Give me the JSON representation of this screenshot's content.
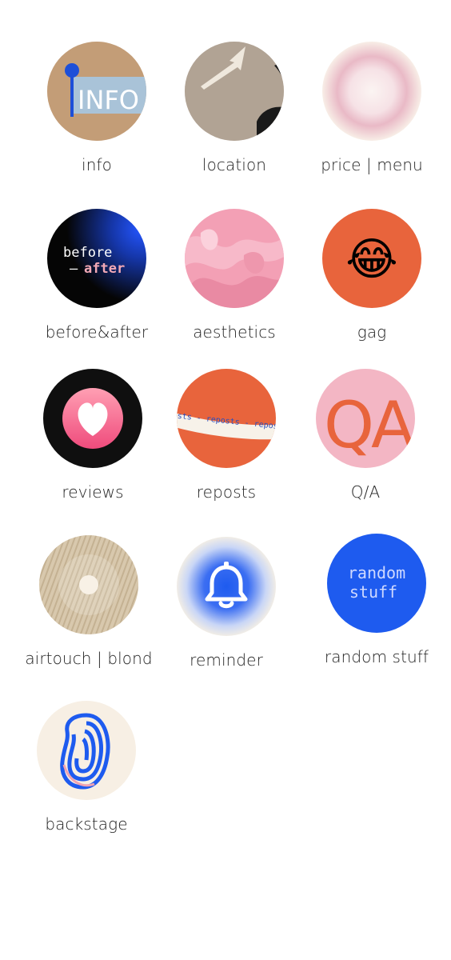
{
  "highlights": [
    {
      "label": "info",
      "icon": "info-sign-icon",
      "cover_text": "INFO"
    },
    {
      "label": "location",
      "icon": "location-arrow-icon"
    },
    {
      "label": "price | menu",
      "icon": "pink-glow-icon"
    },
    {
      "label": "before&after",
      "icon": "before-after-icon",
      "cover_text": "before",
      "cover_text_2": "after",
      "cover_dash": "—"
    },
    {
      "label": "aesthetics",
      "icon": "pink-cream-icon"
    },
    {
      "label": "gag",
      "icon": "laughing-emoji-icon",
      "cover_text": "😂"
    },
    {
      "label": "reviews",
      "icon": "heart-icon"
    },
    {
      "label": "reposts",
      "icon": "reposts-ribbon-icon",
      "cover_text": "osts - reposts - repost"
    },
    {
      "label": "Q/A",
      "icon": "qa-letters-icon",
      "cover_text": "QA"
    },
    {
      "label": "airtouch | blond",
      "icon": "blond-hair-icon"
    },
    {
      "label": "reminder",
      "icon": "bell-icon"
    },
    {
      "label": "random stuff",
      "icon": "random-stuff-icon",
      "cover_text": "random",
      "cover_text_2": "stuff"
    },
    {
      "label": "backstage",
      "icon": "backstage-swirl-icon"
    }
  ],
  "colors": {
    "orange": "#e8643c",
    "blue": "#1e5bef",
    "pink": "#f3b6c4",
    "cream": "#f7efe4"
  }
}
